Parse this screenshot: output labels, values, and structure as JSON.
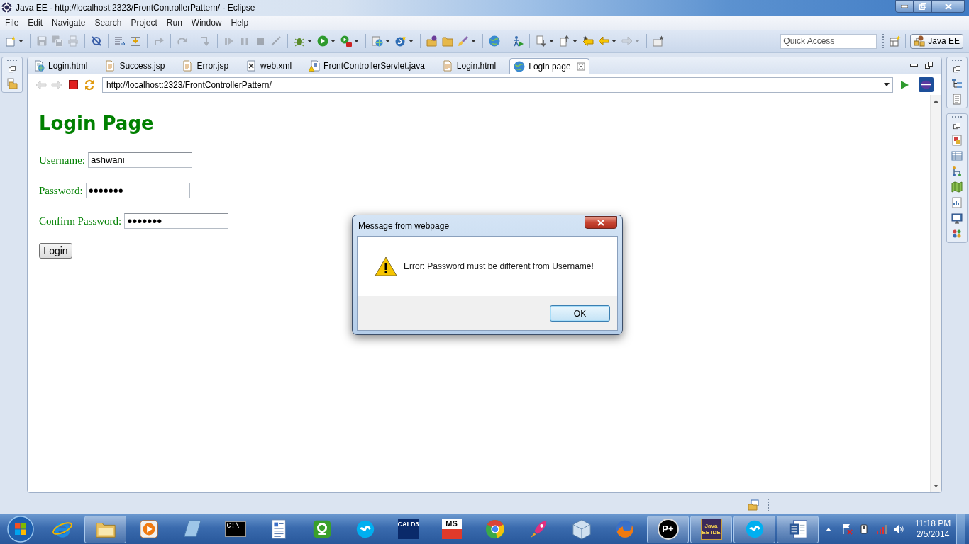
{
  "window": {
    "title": "Java EE - http://localhost:2323/FrontControllerPattern/ - Eclipse"
  },
  "menu": [
    "File",
    "Edit",
    "Navigate",
    "Search",
    "Project",
    "Run",
    "Window",
    "Help"
  ],
  "toolbar": {
    "groups": [
      [
        {
          "kind": "new",
          "disabled": false,
          "dropdown": true
        }
      ],
      [
        {
          "kind": "save",
          "disabled": true,
          "dropdown": false
        },
        {
          "kind": "save_all",
          "disabled": true,
          "dropdown": false
        },
        {
          "kind": "print",
          "disabled": true,
          "dropdown": false
        }
      ],
      [
        {
          "kind": "skip",
          "disabled": false,
          "dropdown": false
        }
      ],
      [
        {
          "kind": "console",
          "disabled": false,
          "dropdown": false
        },
        {
          "kind": "swap",
          "disabled": false,
          "dropdown": false
        }
      ],
      [
        {
          "kind": "step_into",
          "disabled": true,
          "dropdown": false
        }
      ],
      [
        {
          "kind": "redo",
          "disabled": true,
          "dropdown": false
        }
      ],
      [
        {
          "kind": "step_return",
          "disabled": true,
          "dropdown": false
        }
      ],
      [
        {
          "kind": "resume",
          "disabled": true,
          "dropdown": false
        },
        {
          "kind": "pause",
          "disabled": true,
          "dropdown": false
        },
        {
          "kind": "stop",
          "disabled": true,
          "dropdown": false
        },
        {
          "kind": "disconnect",
          "disabled": true,
          "dropdown": false
        }
      ],
      [
        {
          "kind": "debug",
          "disabled": false,
          "dropdown": true
        },
        {
          "kind": "run",
          "disabled": false,
          "dropdown": true
        },
        {
          "kind": "run_tool",
          "disabled": false,
          "dropdown": true
        }
      ],
      [
        {
          "kind": "server",
          "disabled": false,
          "dropdown": true
        },
        {
          "kind": "class",
          "disabled": false,
          "dropdown": true
        }
      ],
      [
        {
          "kind": "open_type",
          "disabled": false,
          "dropdown": false
        },
        {
          "kind": "folder",
          "disabled": false,
          "dropdown": false
        },
        {
          "kind": "brush",
          "disabled": false,
          "dropdown": true
        }
      ],
      [
        {
          "kind": "globe",
          "disabled": false,
          "dropdown": false
        }
      ],
      [
        {
          "kind": "figure",
          "disabled": false,
          "dropdown": false
        }
      ],
      [
        {
          "kind": "next_annotation",
          "disabled": false,
          "dropdown": true
        },
        {
          "kind": "prev_annotation",
          "disabled": false,
          "dropdown": true
        },
        {
          "kind": "last_edit",
          "disabled": false,
          "dropdown": false
        },
        {
          "kind": "back",
          "disabled": false,
          "dropdown": true
        },
        {
          "kind": "forward",
          "disabled": true,
          "dropdown": true
        }
      ],
      [
        {
          "kind": "pin",
          "disabled": false,
          "dropdown": false
        }
      ]
    ],
    "quick_access": {
      "placeholder": "Quick Access"
    },
    "perspectives": [
      {
        "label": "Java EE",
        "selected": true
      }
    ]
  },
  "editor_tabs": [
    {
      "label": "Login.html",
      "kind": "html",
      "selected": false
    },
    {
      "label": "Success.jsp",
      "kind": "jsp",
      "selected": false
    },
    {
      "label": "Error.jsp",
      "kind": "jsp",
      "selected": false
    },
    {
      "label": "web.xml",
      "kind": "xml",
      "selected": false
    },
    {
      "label": "FrontControllerServlet.java",
      "kind": "java",
      "selected": false
    },
    {
      "label": "Login.html",
      "kind": "jsp",
      "selected": false
    },
    {
      "label": "Login page",
      "kind": "browser",
      "selected": true
    }
  ],
  "browser": {
    "back": {
      "disabled": true
    },
    "forward": {
      "disabled": true
    },
    "url": "http://localhost:2323/FrontControllerPattern/",
    "page": {
      "heading": "Login Page",
      "fields": [
        {
          "label": "Username:",
          "kind": "text",
          "value": "ashwani"
        },
        {
          "label": "Password:",
          "kind": "password",
          "value": "•••••••"
        },
        {
          "label": "Confirm Password:",
          "kind": "password",
          "value": "•••••••"
        }
      ],
      "button": "Login"
    }
  },
  "dialog": {
    "title": "Message from webpage",
    "message": "Error: Password must be different from Username!",
    "button": "OK"
  },
  "taskbar": {
    "apps": [
      {
        "kind": "ie",
        "running": false
      },
      {
        "kind": "explorer",
        "running": true
      },
      {
        "kind": "media",
        "running": false
      },
      {
        "kind": "notes",
        "running": false
      },
      {
        "kind": "terminal",
        "label": "C:\\",
        "running": false
      },
      {
        "kind": "wordpad",
        "running": false
      },
      {
        "kind": "green",
        "running": false
      },
      {
        "kind": "skype",
        "running": false
      },
      {
        "kind": "cald",
        "label": "CALD3",
        "running": false
      },
      {
        "kind": "ms",
        "label": "MS",
        "running": false
      },
      {
        "kind": "chrome",
        "running": false
      },
      {
        "kind": "rocket",
        "running": false
      },
      {
        "kind": "cube",
        "running": false
      },
      {
        "kind": "firefox",
        "running": false
      },
      {
        "kind": "pplus",
        "label": "P+",
        "running": true
      },
      {
        "kind": "javaide",
        "label": "Java EE IDE",
        "running": true
      },
      {
        "kind": "skype",
        "running": true
      },
      {
        "kind": "word",
        "running": true
      }
    ],
    "clock": {
      "time": "11:18 PM",
      "date": "2/5/2014"
    }
  }
}
